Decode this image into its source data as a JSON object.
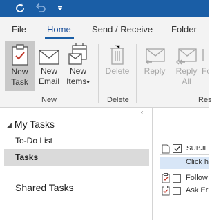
{
  "quick_access": {
    "icons": [
      "refresh-icon",
      "undo-icon",
      "customize-dropdown-icon"
    ],
    "background": "#1a5ea6"
  },
  "tabs": [
    {
      "label": "File"
    },
    {
      "label": "Home"
    },
    {
      "label": "Send / Receive"
    },
    {
      "label": "Folder"
    }
  ],
  "ribbon": {
    "new_task_line1": "New",
    "new_task_line2": "Task",
    "new_email_line1": "New",
    "new_email_line2": "Email",
    "new_items_line1": "New",
    "new_items_line2": "Items",
    "new_items_arrow": "▾",
    "delete_label": "Delete",
    "reply_line1": "Reply",
    "reply_all_line1": "Reply",
    "reply_all_line2": "All",
    "forward_partial": "Fo",
    "groups": {
      "new": "New",
      "delete": "Delete",
      "respond_partial": "Res"
    }
  },
  "nav": {
    "collapse_glyph": "‹",
    "header": "My Tasks",
    "header_expand_glyph": "◢",
    "items": [
      {
        "label": "To-Do List"
      },
      {
        "label": "Tasks"
      }
    ],
    "shared": "Shared Tasks"
  },
  "task_list": {
    "subject_header": "SUBJE",
    "new_task_placeholder": "Click h",
    "rows": [
      {
        "subject": "Follow"
      },
      {
        "subject": "Ask Er"
      }
    ]
  }
}
